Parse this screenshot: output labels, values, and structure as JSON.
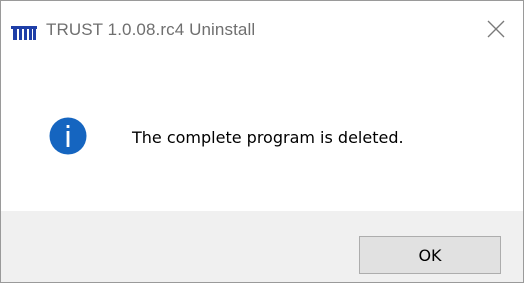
{
  "window": {
    "title": "TRUST 1.0.08.rc4 Uninstall",
    "app_icon": "trust-logo-icon",
    "close_icon": "close-icon"
  },
  "dialog": {
    "icon": "info-icon",
    "message": "The complete program is deleted."
  },
  "buttons": {
    "ok_label": "OK"
  },
  "colors": {
    "info_blue": "#1565c0",
    "logo_blue": "#1f3fa8",
    "title_gray": "#6f6f6f",
    "footer_bg": "#f0f0f0",
    "button_bg": "#e1e1e1",
    "button_border": "#adadad"
  }
}
